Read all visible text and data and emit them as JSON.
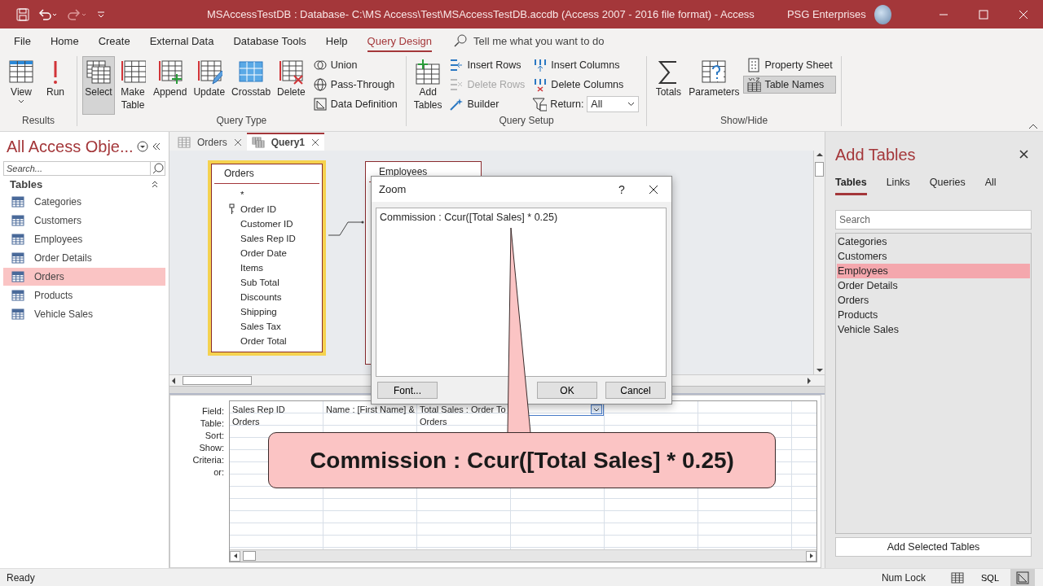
{
  "window": {
    "title": "MSAccessTestDB : Database- C:\\MS Access\\Test\\MSAccessTestDB.accdb (Access 2007 - 2016 file format)  -  Access",
    "account": "PSG Enterprises"
  },
  "menu_tabs": [
    {
      "label": "File",
      "selected": false
    },
    {
      "label": "Home",
      "selected": false
    },
    {
      "label": "Create",
      "selected": false
    },
    {
      "label": "External Data",
      "selected": false
    },
    {
      "label": "Database Tools",
      "selected": false
    },
    {
      "label": "Help",
      "selected": false
    },
    {
      "label": "Query Design",
      "selected": true
    }
  ],
  "tell_me": {
    "placeholder": "Tell me what you want to do"
  },
  "ribbon": {
    "groups": [
      {
        "label": "Results",
        "columns": [
          [
            {
              "kind": "large",
              "label": "View",
              "dropdown": true,
              "selected": false,
              "disabled": false
            }
          ],
          [
            {
              "kind": "large",
              "label": "Run",
              "dropdown": false,
              "selected": false,
              "disabled": false
            }
          ]
        ]
      },
      {
        "label": "Query Type",
        "columns": [
          [
            {
              "kind": "large",
              "label": "Select",
              "dropdown": false,
              "selected": true,
              "disabled": false
            }
          ],
          [
            {
              "kind": "large",
              "label": "Make\nTable",
              "dropdown": false,
              "selected": false,
              "disabled": false
            }
          ],
          [
            {
              "kind": "large",
              "label": "Append",
              "dropdown": false,
              "selected": false,
              "disabled": false
            }
          ],
          [
            {
              "kind": "large",
              "label": "Update",
              "dropdown": false,
              "selected": false,
              "disabled": false
            }
          ],
          [
            {
              "kind": "large",
              "label": "Crosstab",
              "dropdown": false,
              "selected": false,
              "disabled": false
            }
          ],
          [
            {
              "kind": "large",
              "label": "Delete",
              "dropdown": false,
              "selected": false,
              "disabled": false
            }
          ],
          [
            {
              "kind": "small",
              "label": "Union",
              "selected": false,
              "disabled": false
            },
            {
              "kind": "small",
              "label": "Pass-Through",
              "selected": false,
              "disabled": false
            },
            {
              "kind": "small",
              "label": "Data Definition",
              "selected": false,
              "disabled": false
            }
          ]
        ]
      },
      {
        "label": "Query Setup",
        "columns": [
          [
            {
              "kind": "large",
              "label": "Add\nTables",
              "dropdown": false,
              "selected": false,
              "disabled": false
            }
          ],
          [
            {
              "kind": "small",
              "label": "Insert Rows",
              "selected": false,
              "disabled": false
            },
            {
              "kind": "small",
              "label": "Delete Rows",
              "selected": false,
              "disabled": true
            },
            {
              "kind": "small",
              "label": "Builder",
              "selected": false,
              "disabled": false
            }
          ],
          [
            {
              "kind": "small",
              "label": "Insert Columns",
              "selected": false,
              "disabled": false
            },
            {
              "kind": "small",
              "label": "Delete Columns",
              "selected": false,
              "disabled": false
            },
            {
              "kind": "dropdown",
              "label": "Return:",
              "value": "All"
            }
          ]
        ]
      },
      {
        "label": "Show/Hide",
        "columns": [
          [
            {
              "kind": "large",
              "label": "Totals",
              "dropdown": false,
              "selected": false,
              "disabled": false
            }
          ],
          [
            {
              "kind": "large",
              "label": "Parameters",
              "dropdown": false,
              "selected": false,
              "disabled": false
            }
          ],
          [
            {
              "kind": "small",
              "label": "Property Sheet",
              "selected": false,
              "disabled": false
            },
            {
              "kind": "small",
              "label": "Table Names",
              "selected": true,
              "disabled": false
            }
          ]
        ]
      }
    ]
  },
  "nav_pane": {
    "title": "All Access Obje...",
    "search": {
      "placeholder": "Search..."
    },
    "group": "Tables",
    "items": [
      {
        "label": "Categories",
        "selected": false
      },
      {
        "label": "Customers",
        "selected": false
      },
      {
        "label": "Employees",
        "selected": false
      },
      {
        "label": "Order Details",
        "selected": false
      },
      {
        "label": "Orders",
        "selected": true
      },
      {
        "label": "Products",
        "selected": false
      },
      {
        "label": "Vehicle Sales",
        "selected": false
      }
    ]
  },
  "document_tabs": [
    {
      "label": "Orders",
      "kind": "table",
      "selected": false
    },
    {
      "label": "Query1",
      "kind": "query",
      "selected": true
    }
  ],
  "design_tables": [
    {
      "title": "Orders",
      "selected": true,
      "fields": [
        {
          "name": "*",
          "key": false
        },
        {
          "name": "Order ID",
          "key": true
        },
        {
          "name": "Customer ID",
          "key": false
        },
        {
          "name": "Sales Rep ID",
          "key": false
        },
        {
          "name": "Order Date",
          "key": false
        },
        {
          "name": "Items",
          "key": false
        },
        {
          "name": "Sub Total",
          "key": false
        },
        {
          "name": "Discounts",
          "key": false
        },
        {
          "name": "Shipping",
          "key": false
        },
        {
          "name": "Sales Tax",
          "key": false
        },
        {
          "name": "Order Total",
          "key": false
        }
      ]
    },
    {
      "title": "Employees",
      "selected": false
    }
  ],
  "query_grid": {
    "row_labels": [
      "Field:",
      "Table:",
      "Sort:",
      "Show:",
      "Criteria:",
      "or:"
    ],
    "columns": [
      {
        "field": "Sales Rep ID",
        "table": "Orders",
        "focused": false
      },
      {
        "field": "Name : [First Name] &",
        "focused": false
      },
      {
        "field": "Total Sales : Order To",
        "table": "Orders",
        "focused": false
      },
      {
        "focused": true
      },
      {
        "focused": false
      },
      {
        "focused": false
      },
      {
        "focused": false
      }
    ]
  },
  "zoom_dialog": {
    "title": "Zoom",
    "help": "?",
    "text": "Commission : Ccur([Total Sales] * 0.25)",
    "buttons": [
      {
        "label": "Font...",
        "kind": "font"
      },
      {
        "label": "OK",
        "kind": "ok"
      },
      {
        "label": "Cancel",
        "kind": "cancel"
      }
    ]
  },
  "callout": {
    "text": "Commission : Ccur([Total Sales] * 0.25)"
  },
  "add_tables": {
    "title": "Add Tables",
    "tabs": [
      {
        "label": "Tables",
        "selected": true
      },
      {
        "label": "Links",
        "selected": false
      },
      {
        "label": "Queries",
        "selected": false
      },
      {
        "label": "All",
        "selected": false
      }
    ],
    "search": {
      "placeholder": "Search"
    },
    "items": [
      {
        "label": "Categories",
        "selected": false
      },
      {
        "label": "Customers",
        "selected": false
      },
      {
        "label": "Employees",
        "selected": true
      },
      {
        "label": "Order Details",
        "selected": false
      },
      {
        "label": "Orders",
        "selected": false
      },
      {
        "label": "Products",
        "selected": false
      },
      {
        "label": "Vehicle Sales",
        "selected": false
      }
    ],
    "button": "Add Selected Tables"
  },
  "status_bar": {
    "text": "Ready",
    "indicator": "Num Lock",
    "views": [
      {
        "kind": "datasheet",
        "selected": false
      },
      {
        "kind": "sql",
        "label": "SQL",
        "selected": false
      },
      {
        "kind": "design",
        "selected": true
      }
    ]
  }
}
